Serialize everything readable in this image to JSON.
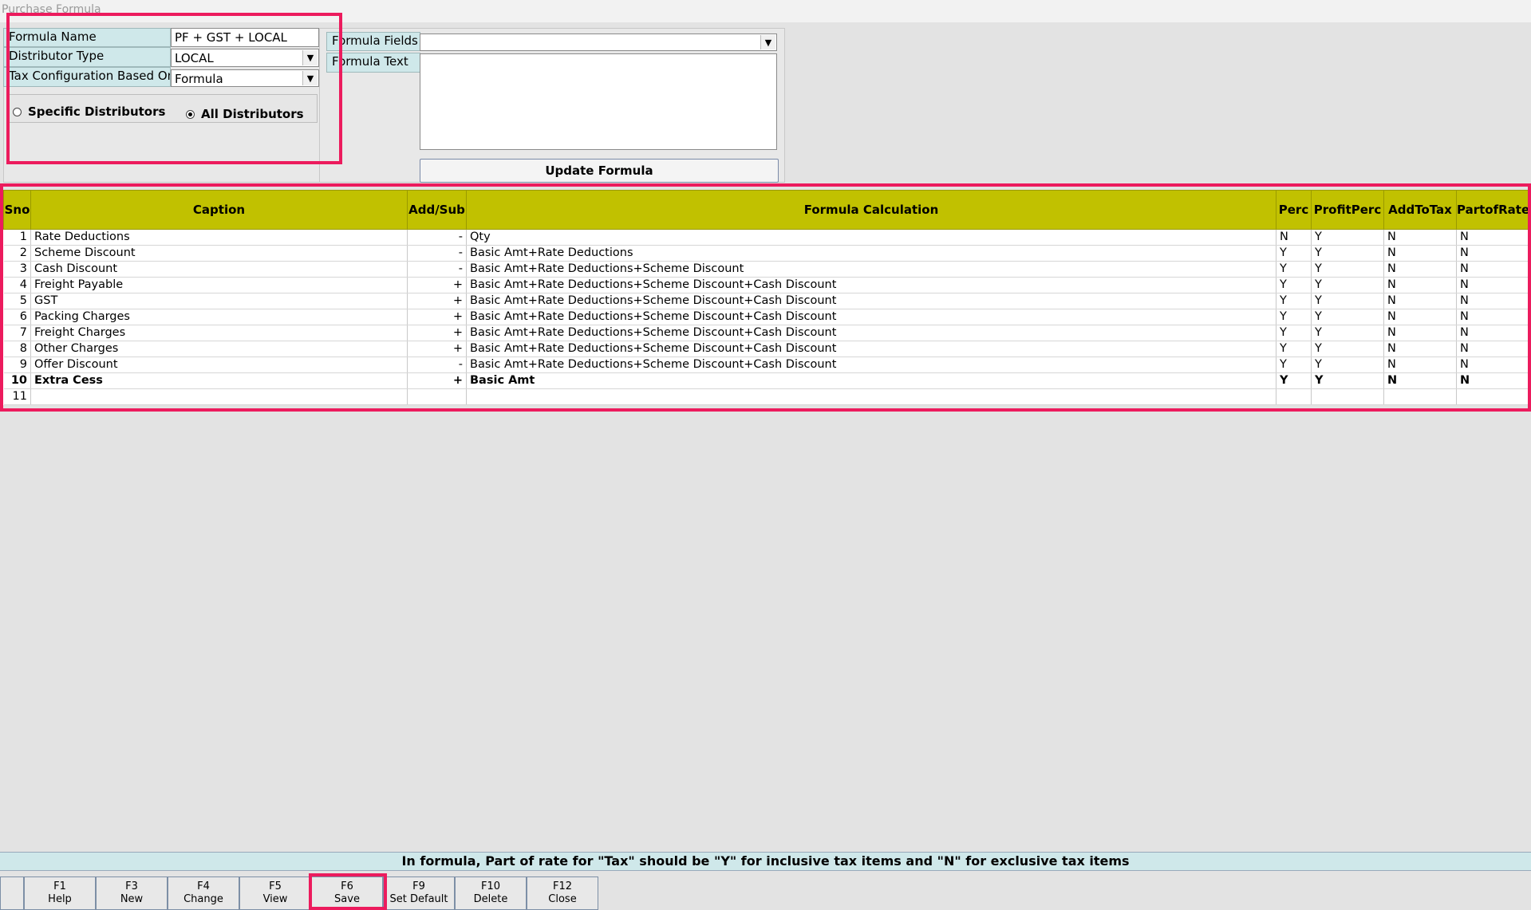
{
  "window": {
    "title": "Purchase Formula"
  },
  "form": {
    "formula_name_label": "Formula Name",
    "formula_name_value": "PF + GST + LOCAL",
    "distributor_type_label": "Distributor Type",
    "distributor_type_value": "LOCAL",
    "tax_config_label": "Tax Configuration Based On",
    "tax_config_value": "Formula",
    "radio_specific": "Specific Distributors",
    "radio_all": "All Distributors",
    "selected_radio": "All Distributors"
  },
  "formula_panel": {
    "fields_label": "Formula Fields",
    "fields_value": "",
    "text_label": "Formula Text",
    "text_value": "",
    "update_button": "Update Formula"
  },
  "grid": {
    "columns": [
      "Sno",
      "Caption",
      "Add/Sub",
      "Formula Calculation",
      "Perc",
      "ProfitPerc",
      "AddToTax",
      "PartofRate"
    ],
    "rows": [
      {
        "sno": "1",
        "caption": "Rate Deductions",
        "addsub": "-",
        "formula": "Qty",
        "perc": "N",
        "profit": "Y",
        "addtotax": "N",
        "partofrate": "N"
      },
      {
        "sno": "2",
        "caption": "Scheme Discount",
        "addsub": "-",
        "formula": "Basic Amt+Rate Deductions",
        "perc": "Y",
        "profit": "Y",
        "addtotax": "N",
        "partofrate": "N"
      },
      {
        "sno": "3",
        "caption": "Cash Discount",
        "addsub": "-",
        "formula": "Basic Amt+Rate Deductions+Scheme Discount",
        "perc": "Y",
        "profit": "Y",
        "addtotax": "N",
        "partofrate": "N"
      },
      {
        "sno": "4",
        "caption": "Freight Payable",
        "addsub": "+",
        "formula": "Basic Amt+Rate Deductions+Scheme Discount+Cash Discount",
        "perc": "Y",
        "profit": "Y",
        "addtotax": "N",
        "partofrate": "N"
      },
      {
        "sno": "5",
        "caption": "GST",
        "addsub": "+",
        "formula": "Basic Amt+Rate Deductions+Scheme Discount+Cash Discount",
        "perc": "Y",
        "profit": "Y",
        "addtotax": "N",
        "partofrate": "N"
      },
      {
        "sno": "6",
        "caption": "Packing Charges",
        "addsub": "+",
        "formula": "Basic Amt+Rate Deductions+Scheme Discount+Cash Discount",
        "perc": "Y",
        "profit": "Y",
        "addtotax": "N",
        "partofrate": "N"
      },
      {
        "sno": "7",
        "caption": "Freight Charges",
        "addsub": "+",
        "formula": "Basic Amt+Rate Deductions+Scheme Discount+Cash Discount",
        "perc": "Y",
        "profit": "Y",
        "addtotax": "N",
        "partofrate": "N"
      },
      {
        "sno": "8",
        "caption": "Other Charges",
        "addsub": "+",
        "formula": "Basic Amt+Rate Deductions+Scheme Discount+Cash Discount",
        "perc": "Y",
        "profit": "Y",
        "addtotax": "N",
        "partofrate": "N"
      },
      {
        "sno": "9",
        "caption": "Offer Discount",
        "addsub": "-",
        "formula": "Basic Amt+Rate Deductions+Scheme Discount+Cash Discount",
        "perc": "Y",
        "profit": "Y",
        "addtotax": "N",
        "partofrate": "N"
      },
      {
        "sno": "10",
        "caption": "Extra Cess",
        "addsub": "+",
        "formula": "Basic Amt",
        "perc": "Y",
        "profit": "Y",
        "addtotax": "N",
        "partofrate": "N",
        "bold": true
      },
      {
        "sno": "11",
        "caption": "",
        "addsub": "",
        "formula": "",
        "perc": "",
        "profit": "",
        "addtotax": "",
        "partofrate": ""
      }
    ]
  },
  "status_message": "In formula, Part of rate for \"Tax\" should be \"Y\" for inclusive tax items and \"N\" for exclusive tax items",
  "function_keys": [
    {
      "key": "F1",
      "label": "Help"
    },
    {
      "key": "F3",
      "label": "New"
    },
    {
      "key": "F4",
      "label": "Change"
    },
    {
      "key": "F5",
      "label": "View"
    },
    {
      "key": "F6",
      "label": "Save"
    },
    {
      "key": "F9",
      "label": "Set Default"
    },
    {
      "key": "F10",
      "label": "Delete"
    },
    {
      "key": "F12",
      "label": "Close"
    }
  ],
  "colors": {
    "grid_header": "#c1c100",
    "label_bg": "#cfe8ea",
    "highlight": "#ec1b5d"
  }
}
